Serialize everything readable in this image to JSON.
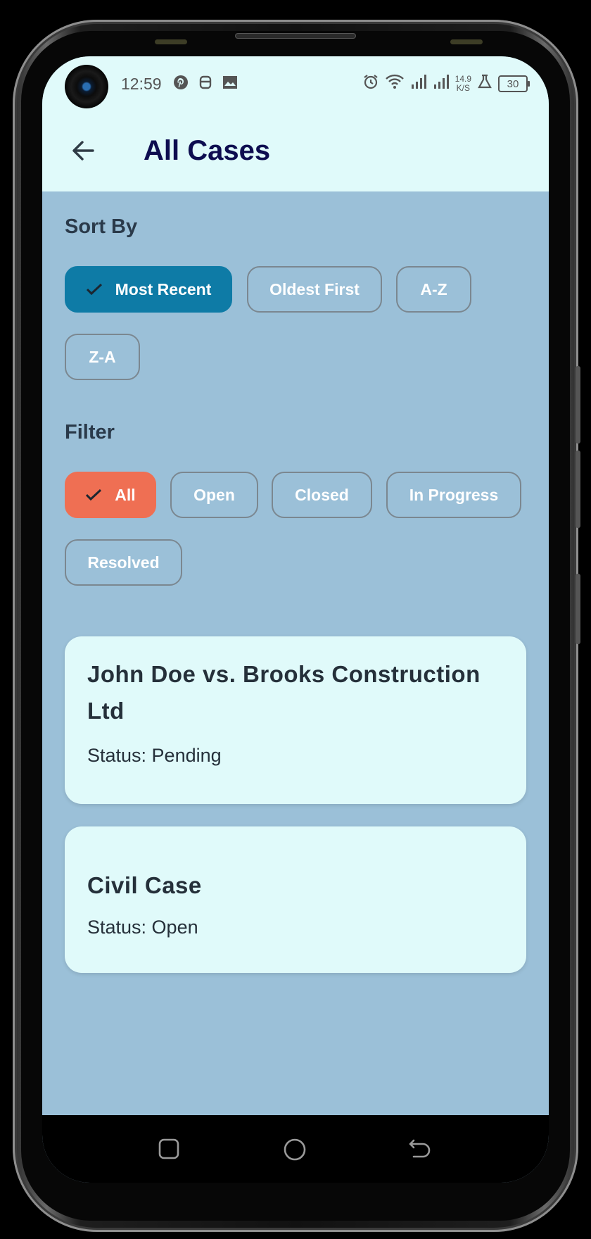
{
  "status_bar": {
    "time": "12:59",
    "net_speed_value": "14.9",
    "net_speed_unit": "K/S",
    "battery": "30",
    "icons": [
      "pinterest-icon",
      "notification-icon",
      "gallery-icon",
      "alarm-icon",
      "wifi-icon",
      "signal-icon",
      "signal-icon",
      "lab-icon"
    ]
  },
  "app_bar": {
    "title": "All Cases",
    "back_icon": "arrow-left-icon"
  },
  "sort": {
    "title": "Sort By",
    "options": [
      {
        "label": "Most Recent",
        "selected": true
      },
      {
        "label": "Oldest First",
        "selected": false
      },
      {
        "label": "A-Z",
        "selected": false
      },
      {
        "label": "Z-A",
        "selected": false
      }
    ]
  },
  "filter": {
    "title": "Filter",
    "options": [
      {
        "label": "All",
        "selected": true
      },
      {
        "label": "Open",
        "selected": false
      },
      {
        "label": "Closed",
        "selected": false
      },
      {
        "label": "In Progress",
        "selected": false
      },
      {
        "label": "Resolved",
        "selected": false
      }
    ]
  },
  "cases": [
    {
      "title": "John Doe vs. Brooks Construction Ltd",
      "status": "Status: Pending"
    },
    {
      "title": "Civil Case",
      "status": "Status: Open"
    }
  ],
  "colors": {
    "app_bar_bg": "#e0fafa",
    "screen_bg": "#9bc0d8",
    "sort_selected": "#0e7ba6",
    "filter_selected": "#ef6f53",
    "title_text": "#0d0d50"
  },
  "nav_bar": {
    "icons": [
      "recent-apps-icon",
      "home-icon",
      "back-nav-icon"
    ]
  }
}
